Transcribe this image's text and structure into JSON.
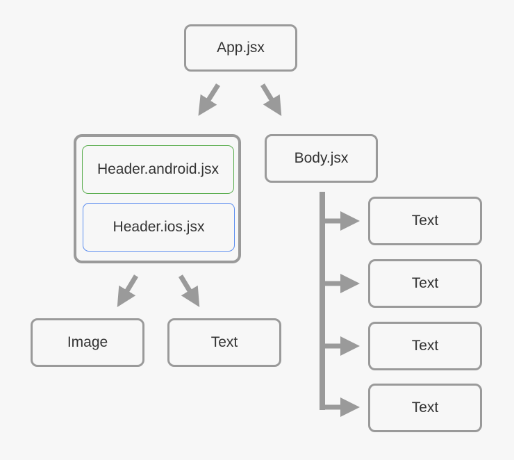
{
  "diagram": {
    "root": {
      "label": "App.jsx"
    },
    "header_group": {
      "variants": [
        {
          "label": "Header.android.jsx",
          "border_color": "#5aad4e"
        },
        {
          "label": "Header.ios.jsx",
          "border_color": "#5b8def"
        }
      ],
      "children": [
        {
          "label": "Image"
        },
        {
          "label": "Text"
        }
      ]
    },
    "body": {
      "label": "Body.jsx",
      "children": [
        {
          "label": "Text"
        },
        {
          "label": "Text"
        },
        {
          "label": "Text"
        },
        {
          "label": "Text"
        }
      ]
    },
    "colors": {
      "background": "#f7f7f7",
      "connector": "#9a9a9a",
      "text": "#333333"
    }
  }
}
